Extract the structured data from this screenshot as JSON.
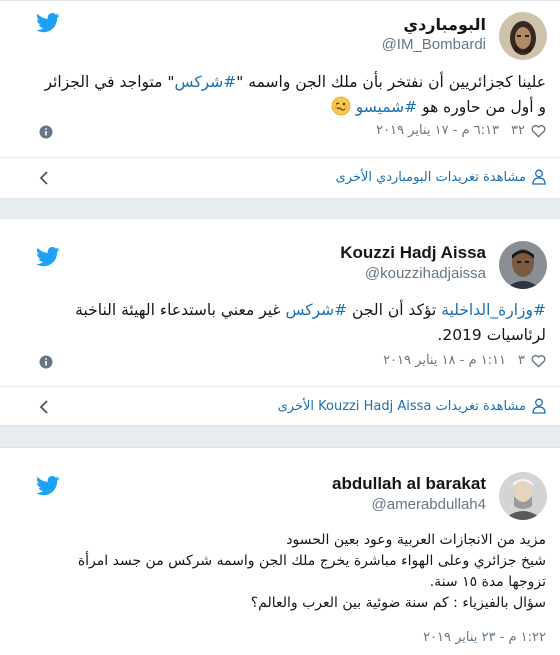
{
  "tweets": [
    {
      "name": "البومباردي",
      "handle": "@IM_Bombardi",
      "text_parts": [
        "علينا كجزائريين أن نفتخر بأن ملك الجن واسمه \"",
        "#شركس",
        "\" متواجد في الجزائر و أول من حاوره هو ",
        "#شميسو"
      ],
      "likes": "٣٢",
      "time": "٦:١٣ م - ١٧ يناير ٢٠١٩",
      "more_label": "مشاهدة تغريدات البومباردي الأخرى"
    },
    {
      "name": "Kouzzi Hadj Aissa",
      "handle": "@kouzzihadjaissa",
      "text_parts": [
        "#وزارة_الداخلية",
        " تؤكد أن الجن  ",
        "#شركس",
        " غير معني باستدعاء الهيئة الناخبة لرئاسيات 2019."
      ],
      "likes": "٣",
      "time": "١:١١ م - ١٨ يناير ٢٠١٩",
      "more_label": "مشاهدة تغريدات Kouzzi Hadj Aissa الأخرى"
    },
    {
      "name": "abdullah al barakat",
      "handle": "@amerabdullah4",
      "lines": [
        "مزيد من الانجازات العربية وعود بعين الحسود",
        "شيخ جزائري وعلى الهواء مباشرة يخرج ملك الجن واسمه شركس من جسد امرأة تزوجها مدة ١٥ سنة.",
        "سؤال بالفيزياء : كم سنة ضوئية بين العرب والعالم؟"
      ],
      "time": "١:٢٢ م - ٢٣ يناير ٢٠١٩"
    }
  ],
  "icons": {
    "bird": "twitter-bird-icon",
    "info": "info-icon",
    "heart": "heart-icon",
    "chevron": "chevron-left-icon",
    "person": "person-icon",
    "emoji": "woozy-face-emoji"
  },
  "colors": {
    "twitter_blue": "#1da1f2",
    "link_blue": "#1b6fae",
    "muted": "#657786",
    "background": "#e6ecf0"
  }
}
